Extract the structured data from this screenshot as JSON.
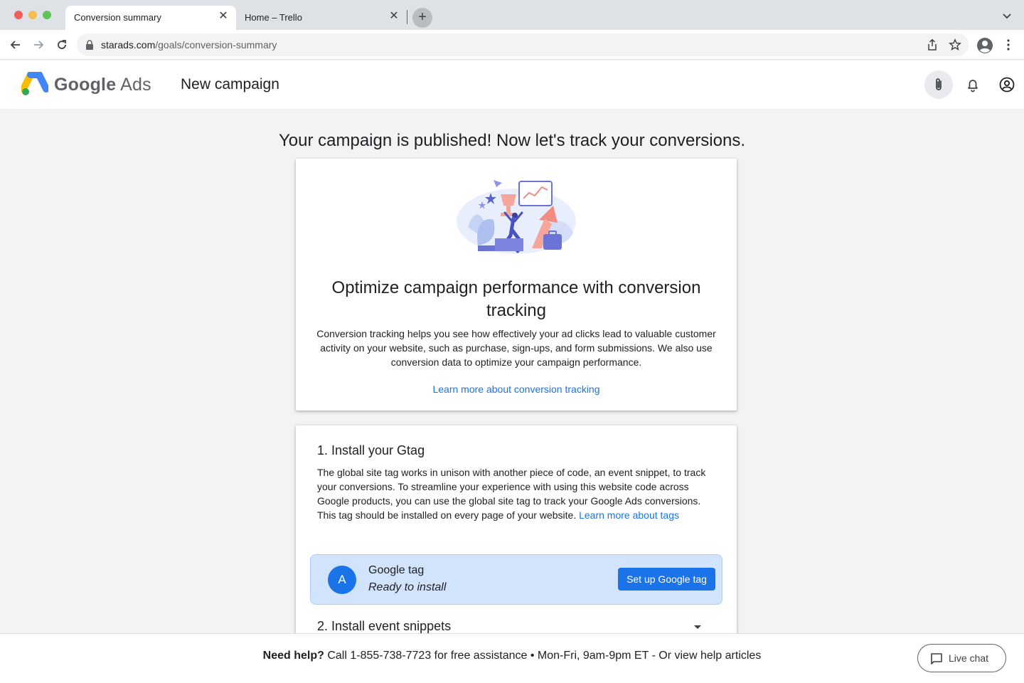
{
  "browser": {
    "tabs": [
      {
        "label": "Conversion summary",
        "active": true
      },
      {
        "label": "Home – Trello",
        "active": false
      }
    ],
    "url": {
      "host": "starads.com",
      "path": "/goals/conversion-summary"
    }
  },
  "app": {
    "brand_word1": "Google",
    "brand_word2": "Ads",
    "page_title": "New campaign"
  },
  "main": {
    "headline": "Your campaign is published! Now let's track your conversions.",
    "hero": {
      "title": "Optimize campaign performance with conversion tracking",
      "body": "Conversion tracking helps you see how effectively your ad clicks lead to valuable customer activity on your website, such as purchase, sign-ups, and form submissions. We also use conversion data to optimize your campaign performance.",
      "link": "Learn more about conversion tracking"
    },
    "step1": {
      "title": "1. Install your Gtag",
      "body": "The global site tag works in unison with another piece of code, an event snippet, to track your conversions. To streamline your experience with using this website code across Google products, you can use the global site tag to track your Google Ads conversions. This tag should be installed on every page of your website.",
      "link": "Learn more about tags"
    },
    "tag": {
      "avatar_letter": "A",
      "name": "Google tag",
      "status": "Ready to install",
      "button": "Set up Google tag"
    },
    "step2": {
      "title": "2. Install event snippets"
    }
  },
  "help": {
    "bold": "Need help?",
    "text": "Call 1-855-738-7723 for free assistance • Mon-Fri, 9am-9pm ET - Or view help articles",
    "live_chat": "Live chat"
  },
  "colors": {
    "accent": "#1a73e8",
    "tag_box": "#d2e3fc"
  }
}
